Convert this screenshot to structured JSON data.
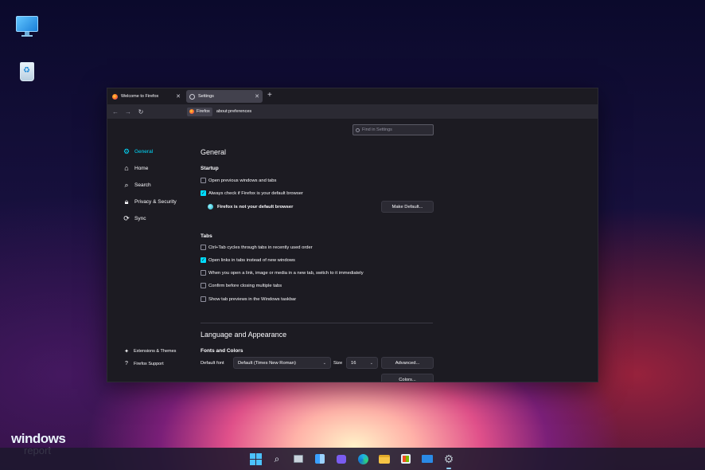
{
  "desktop": {
    "icons": [
      "this-pc-icon",
      "recycle-bin-icon"
    ],
    "brand": {
      "line1": "windows",
      "line2": "report"
    }
  },
  "browser": {
    "tabs": [
      {
        "label": "Welcome to Firefox",
        "close": "✕"
      },
      {
        "label": "Settings",
        "close": "✕"
      }
    ],
    "new_tab": "+",
    "nav": {
      "back": "←",
      "forward": "→",
      "reload": "↻"
    },
    "identity_label": "Firefox",
    "url": "about:preferences"
  },
  "settings": {
    "search_placeholder": "Find in Settings",
    "sidebar": [
      {
        "label": "General",
        "icon": "gear-icon",
        "active": true
      },
      {
        "label": "Home",
        "icon": "home-icon"
      },
      {
        "label": "Search",
        "icon": "search-icon"
      },
      {
        "label": "Privacy & Security",
        "icon": "lock-icon"
      },
      {
        "label": "Sync",
        "icon": "sync-icon"
      }
    ],
    "sidebar_footer": [
      {
        "label": "Extensions & Themes",
        "icon": "puzzle-icon"
      },
      {
        "label": "Firefox Support",
        "icon": "help-icon"
      }
    ],
    "general_title": "General",
    "startup": {
      "title": "Startup",
      "options": [
        {
          "label": "Open previous windows and tabs",
          "checked": false
        },
        {
          "label": "Always check if Firefox is your default browser",
          "checked": true
        }
      ],
      "default_status": "Firefox is not your default browser",
      "make_default_button": "Make Default..."
    },
    "tabs": {
      "title": "Tabs",
      "options": [
        {
          "label": "Ctrl+Tab cycles through tabs in recently used order",
          "checked": false
        },
        {
          "label": "Open links in tabs instead of new windows",
          "checked": true
        },
        {
          "label": "When you open a link, image or media in a new tab, switch to it immediately",
          "checked": false
        },
        {
          "label": "Confirm before closing multiple tabs",
          "checked": false
        },
        {
          "label": "Show tab previews in the Windows taskbar",
          "checked": false
        }
      ]
    },
    "language_title": "Language and Appearance",
    "fonts": {
      "title": "Fonts and Colors",
      "default_font_label": "Default font",
      "default_font_value": "Default (Times New Roman)",
      "size_label": "Size",
      "size_value": "16",
      "advanced_button": "Advanced...",
      "colors_button": "Colors..."
    }
  },
  "taskbar": {
    "icons": [
      "start-icon",
      "search-icon",
      "task-view-icon",
      "widgets-icon",
      "chat-icon",
      "edge-icon",
      "file-explorer-icon",
      "store-icon",
      "mail-icon",
      "settings-icon"
    ]
  },
  "colors": {
    "accent": "#00ddff",
    "window_bg": "#1c1b22",
    "toolbar_bg": "#2b2a33"
  }
}
